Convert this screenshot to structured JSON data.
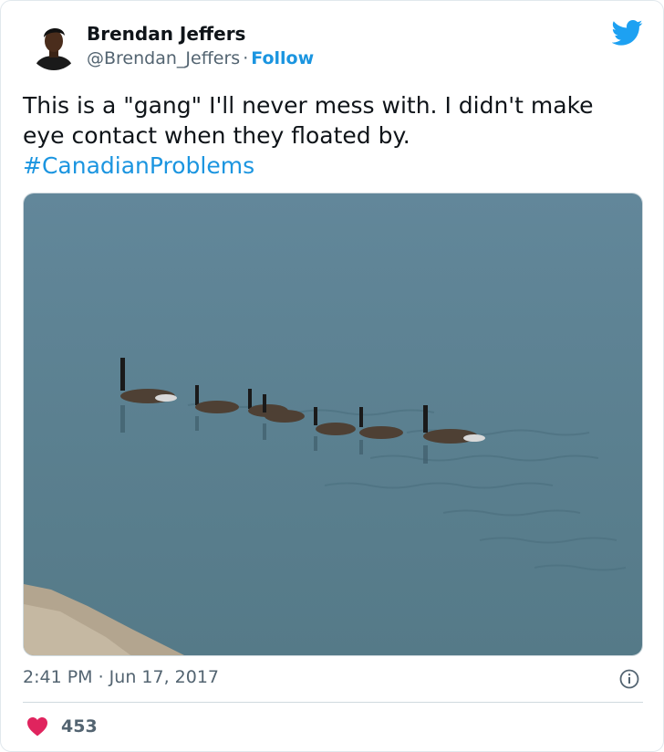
{
  "tweet": {
    "author_name": "Brendan Jeffers",
    "handle": "@Brendan_Jeffers",
    "separator": "·",
    "follow_label": "Follow",
    "text_line1": "This is a \"gang\" I'll never mess with. I didn't make",
    "text_line2": "eye contact when they floated by.",
    "hashtag": "#CanadianProblems",
    "timestamp": "2:41 PM · Jun 17, 2017",
    "like_count": "453"
  },
  "icons": {
    "brand": "twitter-bird-icon",
    "info": "info-icon",
    "like": "heart-icon"
  },
  "colors": {
    "link": "#1b95e0",
    "heart": "#e0245e",
    "secondary_text": "#536471",
    "water": "#5f8393"
  }
}
